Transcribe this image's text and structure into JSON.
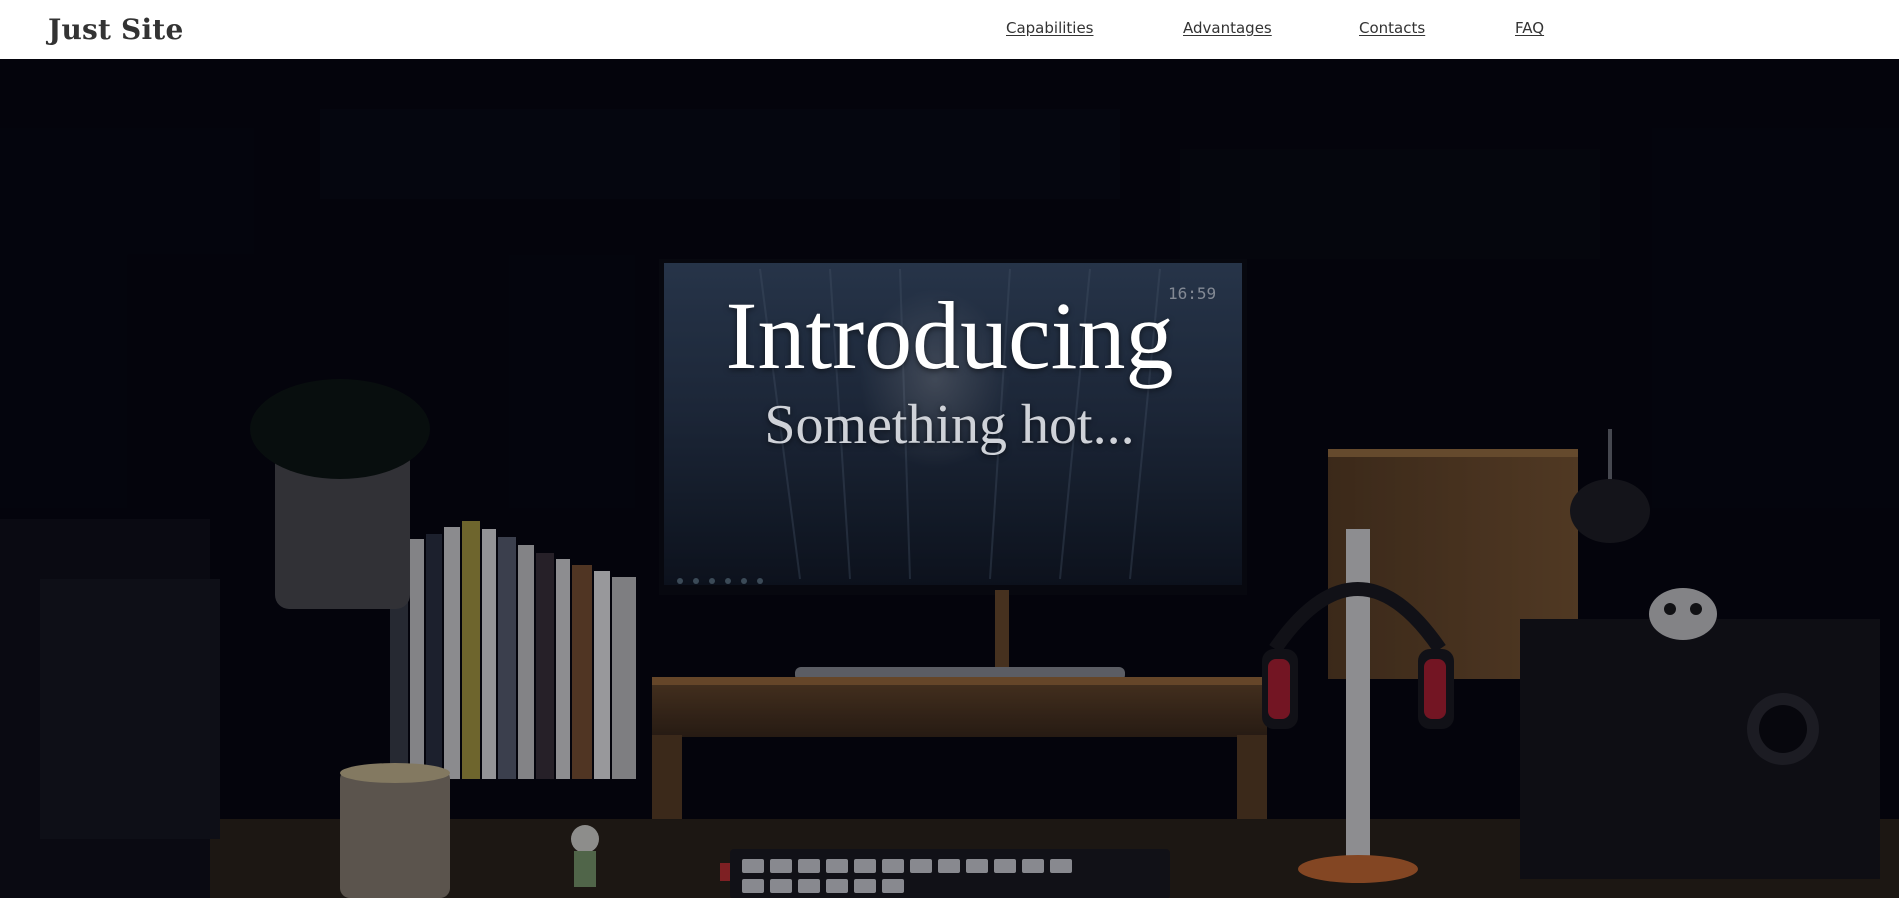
{
  "header": {
    "logo": "Just Site",
    "nav": [
      {
        "label": "Capabilities"
      },
      {
        "label": "Advantages"
      },
      {
        "label": "Contacts"
      },
      {
        "label": "FAQ"
      }
    ]
  },
  "hero": {
    "title": "Introducing",
    "subtitle": "Something hot...",
    "background_image": "dark desk setup with monitor, books, headphones and keyboard",
    "monitor_clock": "16:59"
  },
  "colors": {
    "header_bg": "#ffffff",
    "header_text": "#333333",
    "hero_bg": "#05060c",
    "hero_title": "#ffffff",
    "hero_subtitle": "#cfd2d8"
  }
}
